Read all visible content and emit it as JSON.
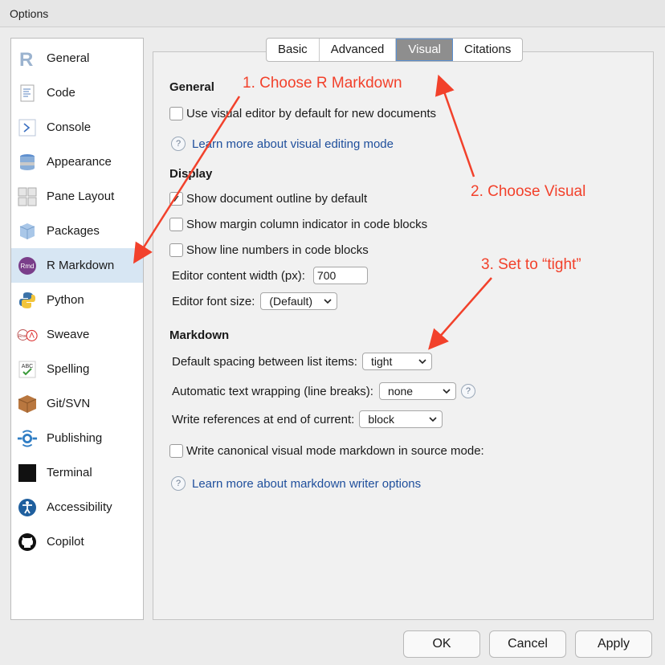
{
  "window": {
    "title": "Options"
  },
  "sidebar": {
    "items": [
      {
        "label": "General",
        "icon": "r-logo-icon"
      },
      {
        "label": "Code",
        "icon": "code-document-icon"
      },
      {
        "label": "Console",
        "icon": "console-prompt-icon"
      },
      {
        "label": "Appearance",
        "icon": "appearance-icon"
      },
      {
        "label": "Pane Layout",
        "icon": "pane-layout-icon"
      },
      {
        "label": "Packages",
        "icon": "packages-icon"
      },
      {
        "label": "R Markdown",
        "icon": "rmd-icon",
        "selected": true
      },
      {
        "label": "Python",
        "icon": "python-icon"
      },
      {
        "label": "Sweave",
        "icon": "sweave-icon"
      },
      {
        "label": "Spelling",
        "icon": "spelling-icon"
      },
      {
        "label": "Git/SVN",
        "icon": "git-box-icon"
      },
      {
        "label": "Publishing",
        "icon": "publishing-icon"
      },
      {
        "label": "Terminal",
        "icon": "terminal-icon"
      },
      {
        "label": "Accessibility",
        "icon": "accessibility-icon"
      },
      {
        "label": "Copilot",
        "icon": "github-icon"
      }
    ]
  },
  "tabs": [
    {
      "label": "Basic"
    },
    {
      "label": "Advanced"
    },
    {
      "label": "Visual",
      "active": true
    },
    {
      "label": "Citations"
    }
  ],
  "general": {
    "title": "General",
    "use_visual_editor": {
      "label": "Use visual editor by default for new documents",
      "checked": false
    },
    "learn_link": "Learn more about visual editing mode"
  },
  "display": {
    "title": "Display",
    "show_outline": {
      "label": "Show document outline by default",
      "checked": true
    },
    "show_margin": {
      "label": "Show margin column indicator in code blocks",
      "checked": false
    },
    "show_line_numbers": {
      "label": "Show line numbers in code blocks",
      "checked": false
    },
    "content_width": {
      "label": "Editor content width (px):",
      "value": "700"
    },
    "font_size": {
      "label": "Editor font size:",
      "value": "(Default)"
    }
  },
  "markdown": {
    "title": "Markdown",
    "list_spacing": {
      "label": "Default spacing between list items:",
      "value": "tight"
    },
    "text_wrapping": {
      "label": "Automatic text wrapping (line breaks):",
      "value": "none"
    },
    "references": {
      "label": "Write references at end of current:",
      "value": "block"
    },
    "canonical": {
      "label": "Write canonical visual mode markdown in source mode:",
      "checked": false
    },
    "learn_link": "Learn more about markdown writer options"
  },
  "buttons": {
    "ok": "OK",
    "cancel": "Cancel",
    "apply": "Apply"
  },
  "annotations": {
    "step1": "1. Choose R Markdown",
    "step2": "2. Choose Visual",
    "step3": "3. Set to “tight”",
    "color": "#f2412b"
  },
  "colors": {
    "selected_row": "#d7e6f3",
    "active_tab": "#8e8e8e",
    "link": "#1f4f9c"
  }
}
